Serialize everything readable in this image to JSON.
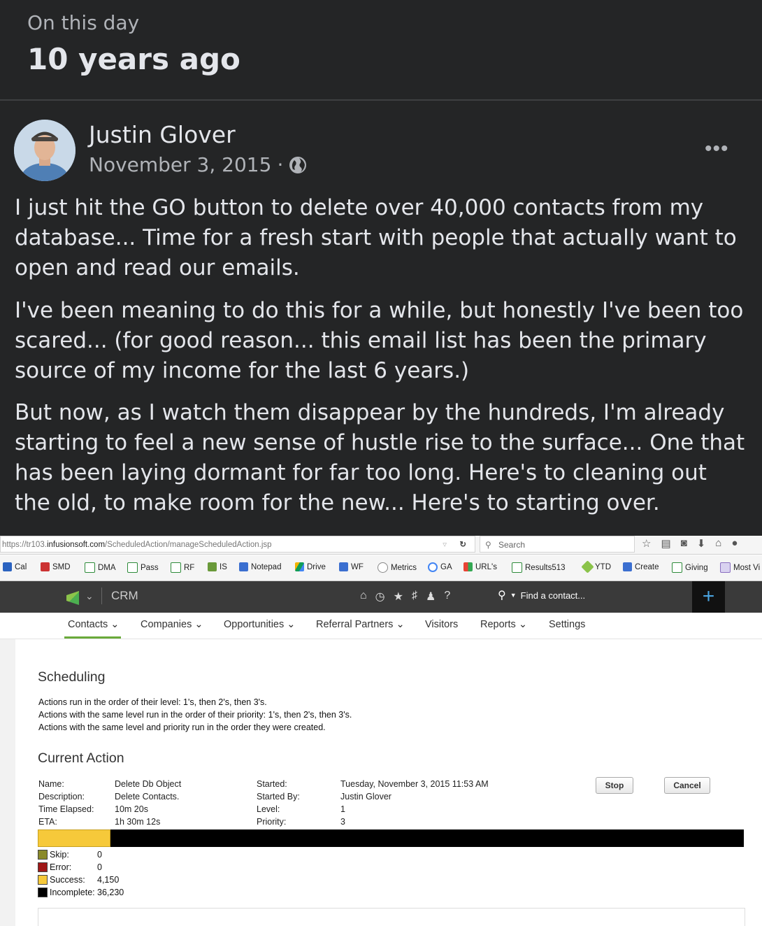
{
  "header": {
    "small": "On this day",
    "big": "10 years ago"
  },
  "post": {
    "author": "Justin Glover",
    "date": "November 3, 2015",
    "separator": "·",
    "privacy_icon": "globe-icon",
    "more_label": "•••",
    "paragraphs": [
      "I just hit the GO button to delete over 40,000 contacts from my database... Time for a fresh start with people that actually want to open and read our emails.",
      "I've been meaning to do this for a while, but honestly I've been too scared... (for good reason... this email list has been the primary source of my income for the last 6 years.)",
      "But now, as I watch them disappear by the hundreds, I'm already starting to feel a new sense of hustle rise to the surface... One that has been laying dormant for far too long. Here's to cleaning out the old, to make room for the new... Here's to starting over."
    ]
  },
  "browser": {
    "url_prefix": "https://tr103.",
    "url_domain": "infusionsoft.com",
    "url_path": "/ScheduledAction/manageScheduledAction.jsp",
    "search_placeholder": "Search",
    "bookmarks": [
      "Cal",
      "SMD",
      "DMA",
      "Pass",
      "RF",
      "IS",
      "Notepad",
      "Drive",
      "WF",
      "Metrics",
      "GA",
      "URL's",
      "Results513",
      "YTD",
      "Create",
      "Giving",
      "Most Vi"
    ]
  },
  "app": {
    "product": "CRM",
    "find_placeholder": "Find a contact...",
    "add_label": "+",
    "tabs": [
      "Contacts",
      "Companies",
      "Opportunities",
      "Referral Partners",
      "Visitors",
      "Reports",
      "Settings"
    ],
    "tab_chevron": "⌄"
  },
  "scheduling": {
    "title": "Scheduling",
    "lines": [
      "Actions run in the order of their level: 1's, then 2's, then 3's.",
      "Actions with the same level run in the order of their priority: 1's, then 2's, then 3's.",
      "Actions with the same level and priority run in the order they were created."
    ]
  },
  "current_action": {
    "title": "Current Action",
    "left_labels": [
      "Name:",
      "Description:",
      "Time Elapsed:",
      "ETA:"
    ],
    "left_values": [
      "Delete Db Object",
      "Delete Contacts.",
      "10m 20s",
      "1h 30m 12s"
    ],
    "right_labels": [
      "Started:",
      "Started By:",
      "Level:",
      "Priority:"
    ],
    "right_values": [
      "Tuesday, November 3, 2015 11:53 AM",
      "Justin Glover",
      "1",
      "3"
    ],
    "stop_label": "Stop",
    "cancel_label": "Cancel",
    "progress_fraction": 0.103,
    "legend": [
      {
        "label": "Skip:",
        "value": "0",
        "color": "#8a8a2a"
      },
      {
        "label": "Error:",
        "value": "0",
        "color": "#a01818"
      },
      {
        "label": "Success:",
        "value": "4,150",
        "color": "#f6c93a"
      },
      {
        "label": "Incomplete:",
        "value": "36,230",
        "color": "#000000"
      }
    ]
  }
}
